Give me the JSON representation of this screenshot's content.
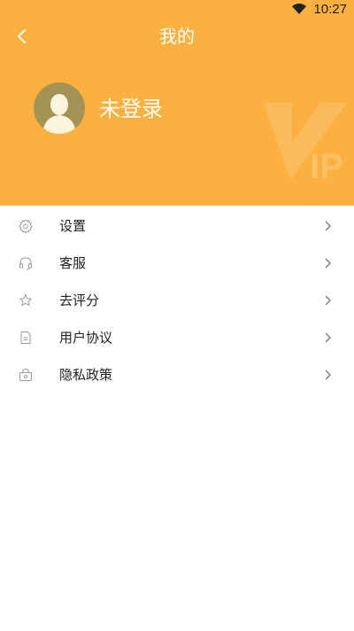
{
  "status_bar": {
    "time": "10:27",
    "wifi_icon": "wifi-icon"
  },
  "header": {
    "title": "我的",
    "back_icon": "chevron-left-icon",
    "login_label": "未登录",
    "avatar_icon": "avatar-icon",
    "watermark": "IP",
    "background_color": "#FBB040"
  },
  "menu": {
    "items": [
      {
        "label": "设置",
        "icon": "gear-icon"
      },
      {
        "label": "客服",
        "icon": "headset-icon"
      },
      {
        "label": "去评分",
        "icon": "star-icon"
      },
      {
        "label": "用户协议",
        "icon": "document-icon"
      },
      {
        "label": "隐私政策",
        "icon": "lock-bag-icon"
      }
    ]
  }
}
